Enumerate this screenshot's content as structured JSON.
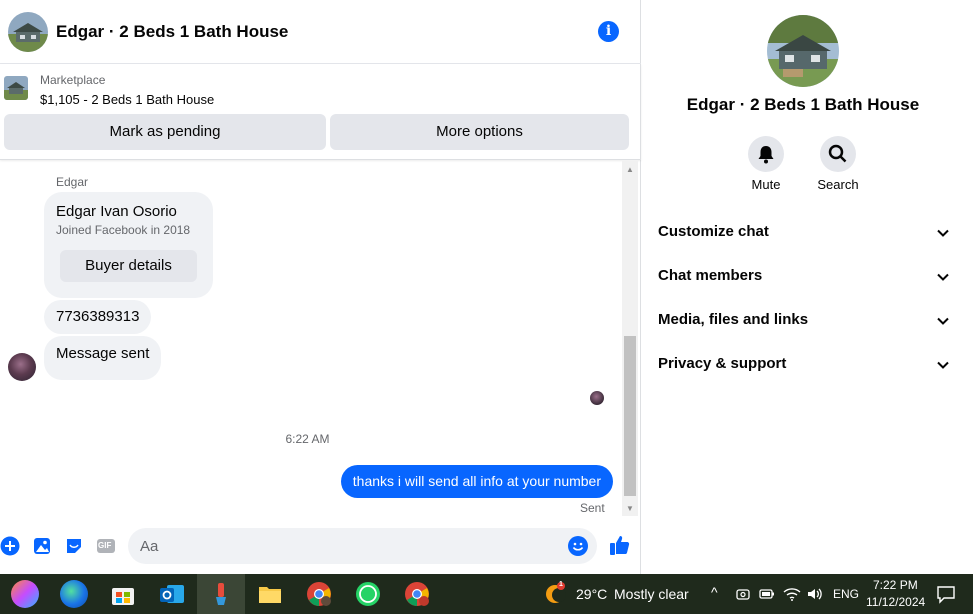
{
  "chat": {
    "title": "Edgar · 2 Beds 1 Bath House",
    "marketplace_label": "Marketplace",
    "listing": "$1,105 - 2 Beds 1 Bath House",
    "mark_pending": "Mark as pending",
    "more_options": "More options"
  },
  "messages": {
    "sender_name": "Edgar",
    "card_name": "Edgar Ivan Osorio",
    "card_sub": "Joined Facebook in 2018",
    "card_button": "Buyer details",
    "phone": "7736389313",
    "message_sent": "Message sent",
    "timestamp": "6:22 AM",
    "outgoing": "thanks i will send all info at your number",
    "status": "Sent"
  },
  "composer": {
    "placeholder": "Aa",
    "gif_label": "GIF"
  },
  "side": {
    "title": "Edgar · 2 Beds 1 Bath House",
    "mute_label": "Mute",
    "search_label": "Search",
    "sections": [
      "Customize chat",
      "Chat members",
      "Media, files and links",
      "Privacy & support"
    ]
  },
  "taskbar": {
    "weather_temp": "29°C",
    "weather_desc": "Mostly clear",
    "weather_badge": "1",
    "language": "ENG",
    "time": "7:22 PM",
    "date": "11/12/2024"
  },
  "colors": {
    "messenger_blue": "#0866ff",
    "bubble_gray": "#f0f2f5",
    "button_gray": "#e4e6eb",
    "taskbar": "#1f2a1c"
  }
}
